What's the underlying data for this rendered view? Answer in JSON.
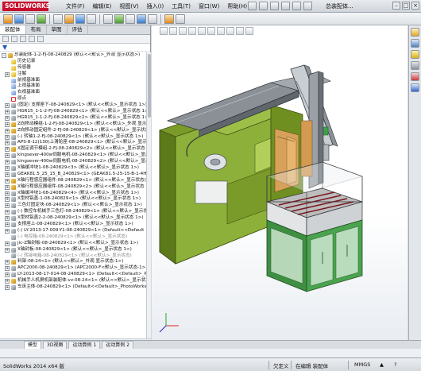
{
  "app": {
    "logo_text": "SOLIDWORKS",
    "doc_title": "总装配体..."
  },
  "menu": [
    "文件(F)",
    "编辑(E)",
    "视图(V)",
    "插入(I)",
    "工具(T)",
    "窗口(W)",
    "帮助(H)"
  ],
  "pane_tabs": [
    "装配体",
    "布局",
    "草图",
    "评估"
  ],
  "tree": [
    {
      "label": "总装配体-1-2-FJ-08-240829 (默认<<默认>_外观 显示状态>)",
      "icon": "assembly-icon",
      "expand": "-",
      "indent": 0
    },
    {
      "label": "历史记录",
      "icon": "folder-icon",
      "expand": "",
      "indent": 1
    },
    {
      "label": "传感器",
      "icon": "folder-icon",
      "expand": "",
      "indent": 1
    },
    {
      "label": "注解",
      "icon": "folder-icon",
      "expand": "+",
      "indent": 1
    },
    {
      "label": "前视基准面",
      "icon": "plane-icon",
      "expand": "",
      "indent": 1
    },
    {
      "label": "上视基准面",
      "icon": "plane-icon",
      "expand": "",
      "indent": 1
    },
    {
      "label": "右视基准面",
      "icon": "plane-icon",
      "expand": "",
      "indent": 1
    },
    {
      "label": "原点",
      "icon": "origin-icon",
      "expand": "",
      "indent": 1
    },
    {
      "label": "(固定) 支撑座下-08-240829<1> (默认<<默认>_显示状态 1>)",
      "icon": "part-icon",
      "expand": "+",
      "indent": 1
    },
    {
      "label": "HGR15_1-1-2-FJ-08-240829<1> (默认<<默认>_显示状态 1>)",
      "icon": "part-icon",
      "expand": "+",
      "indent": 1
    },
    {
      "label": "HGR15_1-1-2-FJ-08-240829<2> (默认<<默认>_显示状态 1>)",
      "icon": "part-icon",
      "expand": "+",
      "indent": 1
    },
    {
      "label": "Z向移动模组-1-2-FJ-08-240829<1> (默认<<默认>_外观 显示)",
      "icon": "assembly-icon",
      "expand": "+",
      "indent": 1
    },
    {
      "label": "Z向移动固定组件-2-FJ-08-240829<1> (默认<<默认>_显示状态)",
      "icon": "assembly-icon",
      "expand": "+",
      "indent": 1
    },
    {
      "label": "(-) 转轴1-2-FJ-08-240829<1> (默认<<默认>_显示状态 1>)",
      "icon": "part-icon",
      "expand": "+",
      "indent": 1
    },
    {
      "label": "APS-8-12(130)上滑轮座-08-240829<1> (默认<<默认>_显示状态)",
      "icon": "part-icon",
      "expand": "+",
      "indent": 1
    },
    {
      "label": "X固定调节模组-2-FJ-08-240829<2> (默认<<默认>_显示状态 1>)",
      "icon": "assembly-icon",
      "expand": "+",
      "indent": 1
    },
    {
      "label": "kingsever-400w伺服电机-08-240829<1> (默认<<默认>_显示状态)",
      "icon": "part-icon",
      "expand": "+",
      "indent": 1
    },
    {
      "label": "kingsever-400w伺服电机-08-240829<2> (默认<<默认>_显示状态)",
      "icon": "part-icon",
      "expand": "+",
      "indent": 1
    },
    {
      "label": "X轴缓冲块1-08-240829<3> (默认<<默认>_显示状态 1>)",
      "icon": "part-icon",
      "expand": "+",
      "indent": 1
    },
    {
      "label": "GEAK81.5_25_15_B_240829<1> (GEAK81.5-25-15-B-1-4H<(默认)",
      "icon": "part-icon",
      "expand": "+",
      "indent": 1
    },
    {
      "label": "X轴行程感应器组件-08-240829<1> (默认<<默认>_显示状态)",
      "icon": "assembly-icon",
      "expand": "+",
      "indent": 1
    },
    {
      "label": "X轴行程感应器组件-08-240829<2> (默认<<默认>_显示状态 1>)",
      "icon": "assembly-icon",
      "expand": "+",
      "indent": 1
    },
    {
      "label": "X轴缓冲块1-08-240829<4> (默认<<默认>_显示状态 1>)",
      "icon": "part-icon",
      "expand": "+",
      "indent": 1
    },
    {
      "label": "X型材铝盖-1-08-240829<1> (默认<<默认>_显示状态 1>)",
      "icon": "part-icon",
      "expand": "+",
      "indent": 1
    },
    {
      "label": "三色灯固定块-08-240829<1> (默认<<默认>_显示状态 1>)",
      "icon": "part-icon",
      "expand": "+",
      "indent": 1
    },
    {
      "label": "(-) 数控车机械手三色灯-08-240829<1> (默认<<默认>_显示状态)",
      "icon": "part-icon",
      "expand": "+",
      "indent": 1
    },
    {
      "label": "X型材铝盖2-2-08-240829<1> (默认<<默认>_显示状态 1>)",
      "icon": "part-icon",
      "expand": "+",
      "indent": 1
    },
    {
      "label": "支撑座上-08-240829<1> (默认<<默认>_显示状态 1>)",
      "icon": "part-icon",
      "expand": "+",
      "indent": 1
    },
    {
      "label": "(-) LY-2013-17-009-Y1-08-240829<1> (Default<<Default",
      "icon": "part-icon",
      "expand": "+",
      "indent": 1
    },
    {
      "label": "(-) 电控箱-08-240829<1> (默认<<默认>_显示状态)",
      "icon": "part-icon",
      "expand": "",
      "indent": 1,
      "dim": true
    },
    {
      "label": "jic-Z轴封板-08-240829<1> (默认<<默认>_显示状态 1>)",
      "icon": "part-icon",
      "expand": "+",
      "indent": 1
    },
    {
      "label": "X轴封板-08-240829<1> (默认<<默认>_显示状态 1>)",
      "icon": "part-icon",
      "expand": "+",
      "indent": 1
    },
    {
      "label": "(-) 转接电箱-08-240829<1> (默认<<默认>_显示状态)",
      "icon": "part-icon",
      "expand": "",
      "indent": 1,
      "dim": true
    },
    {
      "label": "料架-08-24<1> (默认<<默认>_外观 显示状态-1>)",
      "icon": "assembly-icon",
      "expand": "+",
      "indent": 1
    },
    {
      "label": "APC2000-08-240829<1> (APC2000-F<默认>_显示状态-1>)",
      "icon": "part-icon",
      "expand": "+",
      "indent": 1
    },
    {
      "label": "LY-2013-08-17-014-08-240829<1> (Default<<Default>_Pho",
      "icon": "part-icon",
      "expand": "+",
      "indent": 1
    },
    {
      "label": "机械手人机屏机架装配体-vv-08-24<1> (默认<<默认>_显示状态)",
      "icon": "assembly-icon",
      "expand": "+",
      "indent": 1
    },
    {
      "label": "车床主体-08-240829<1> (Default<<Default>_PhotoWorks Display St",
      "icon": "part-icon",
      "expand": "+",
      "indent": 1
    }
  ],
  "bottom_tabs": [
    "模型",
    "3D视图",
    "运动算例 1",
    "运动算例 2"
  ],
  "status": {
    "version": "SolidWorks 2014 x64 版",
    "under_defined": "欠定义",
    "editing": "在编辑 装配体",
    "units": "MMGS"
  }
}
